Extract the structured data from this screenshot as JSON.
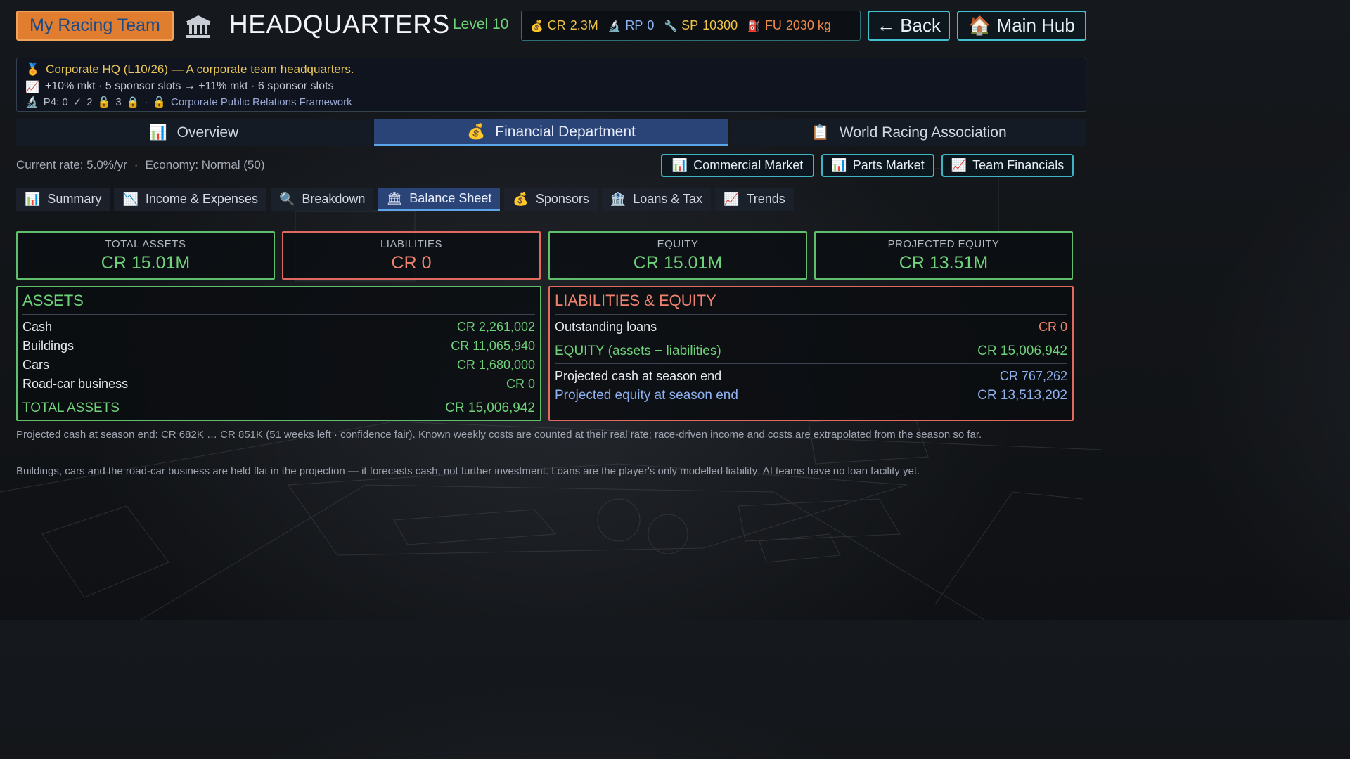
{
  "header": {
    "team_button": "My Racing Team",
    "title": "HEADQUARTERS",
    "level_sep": "·",
    "level": "Level 10",
    "resources": {
      "cr": {
        "label": "CR",
        "value": "2.3M",
        "icon": "money-bag-icon"
      },
      "rp": {
        "label": "RP",
        "value": "0",
        "icon": "microscope-icon"
      },
      "sp": {
        "label": "SP",
        "value": "10300",
        "icon": "wrench-icon"
      },
      "fu": {
        "label": "FU",
        "value": "2030 kg",
        "icon": "fuel-pump-icon"
      }
    },
    "back_label": "← Back",
    "hub_label": "Main Hub"
  },
  "info": {
    "line1": "Corporate HQ  (L10/26) — A corporate team headquarters.",
    "line2": "+10% mkt · 5 sponsor slots → +11% mkt · 6 sponsor slots",
    "line3_prefix": "P4: 0",
    "line3_a": "2",
    "line3_b": "3",
    "line3_sep": "·",
    "line3_project": "Corporate Public Relations Framework"
  },
  "main_tabs": [
    "Overview",
    "Financial Department",
    "World Racing Association"
  ],
  "rate": {
    "current": "Current rate: 5.0%/yr",
    "sep": "·",
    "economy": "Economy: Normal (50)"
  },
  "market_buttons": [
    "Commercial Market",
    "Parts Market",
    "Team Financials"
  ],
  "sub_tabs": [
    "Summary",
    "Income & Expenses",
    "Breakdown",
    "Balance Sheet",
    "Sponsors",
    "Loans & Tax",
    "Trends"
  ],
  "stats": [
    {
      "label": "TOTAL ASSETS",
      "value": "CR 15.01M"
    },
    {
      "label": "LIABILITIES",
      "value": "CR 0"
    },
    {
      "label": "EQUITY",
      "value": "CR 15.01M"
    },
    {
      "label": "PROJECTED EQUITY",
      "value": "CR 13.51M"
    }
  ],
  "assets": {
    "title": "ASSETS",
    "rows": [
      {
        "label": "Cash",
        "value": "CR 2,261,002"
      },
      {
        "label": "Buildings",
        "value": "CR 11,065,940"
      },
      {
        "label": "Cars",
        "value": "CR 1,680,000"
      },
      {
        "label": "Road-car business",
        "value": "CR 0"
      }
    ],
    "total_label": "TOTAL ASSETS",
    "total_value": "CR 15,006,942"
  },
  "liabilities": {
    "title": "LIABILITIES & EQUITY",
    "loans_label": "Outstanding loans",
    "loans_value": "CR 0",
    "equity_label": "EQUITY (assets − liabilities)",
    "equity_value": "CR 15,006,942",
    "proj_cash_label": "Projected cash at season end",
    "proj_cash_value": "CR 767,262",
    "proj_equity_label": "Projected equity at season end",
    "proj_equity_value": "CR 13,513,202"
  },
  "footnotes": {
    "f1": "Projected cash at season end: CR 682K … CR 851K  (51 weeks left · confidence fair). Known weekly costs are counted at their real rate; race-driven income and costs are extrapolated from the season so far.",
    "f2": "Buildings, cars and the road-car business are held flat in the projection — it forecasts cash, not further investment. Loans are the player's only modelled liability; AI teams have no loan facility yet."
  },
  "colors": {
    "accent_cyan": "#42c2cf",
    "positive_green": "#6fd27a",
    "negative_red": "#f0836f",
    "active_tab": "#2b4478",
    "team_orange": "#e07d2e"
  }
}
